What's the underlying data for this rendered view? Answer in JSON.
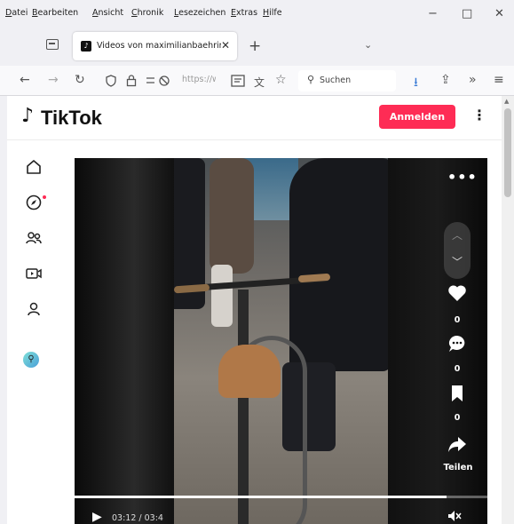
{
  "menu": {
    "items": [
      "Datei",
      "Bearbeiten",
      "Ansicht",
      "Chronik",
      "Lesezeichen",
      "Extras",
      "Hilfe"
    ]
  },
  "window": {
    "minimize": "−",
    "maximize": "□",
    "close": "✕"
  },
  "tab": {
    "title": "Videos von maximilianbaehring",
    "close": "✕",
    "new_tab": "+",
    "list_dropdown": "⌄"
  },
  "nav": {
    "back": "←",
    "forward": "→",
    "reload": "↻",
    "url": "https://ww",
    "search_placeholder": "Suchen",
    "download": "⭳",
    "extensions": "⇪",
    "overflow": "»",
    "menu": "≡"
  },
  "tiktok": {
    "logo_text": "TikTok",
    "login_label": "Anmelden",
    "more_label": "⋮"
  },
  "sidebar": {
    "items": [
      {
        "name": "home",
        "glyph": "⌂"
      },
      {
        "name": "explore",
        "glyph": "◎"
      },
      {
        "name": "following",
        "glyph": "⚇"
      },
      {
        "name": "live",
        "glyph": "▣"
      },
      {
        "name": "profile",
        "glyph": "⚲"
      }
    ]
  },
  "video": {
    "more": "•••",
    "up": "︿",
    "down": "﹀",
    "like_count": "0",
    "comment_count": "0",
    "save_count": "0",
    "share_label": "Teilen",
    "time": "03:12 / 03:4",
    "progress_fraction": 0.9
  },
  "colors": {
    "accent": "#fe2c55",
    "video_bg": "#111111"
  }
}
